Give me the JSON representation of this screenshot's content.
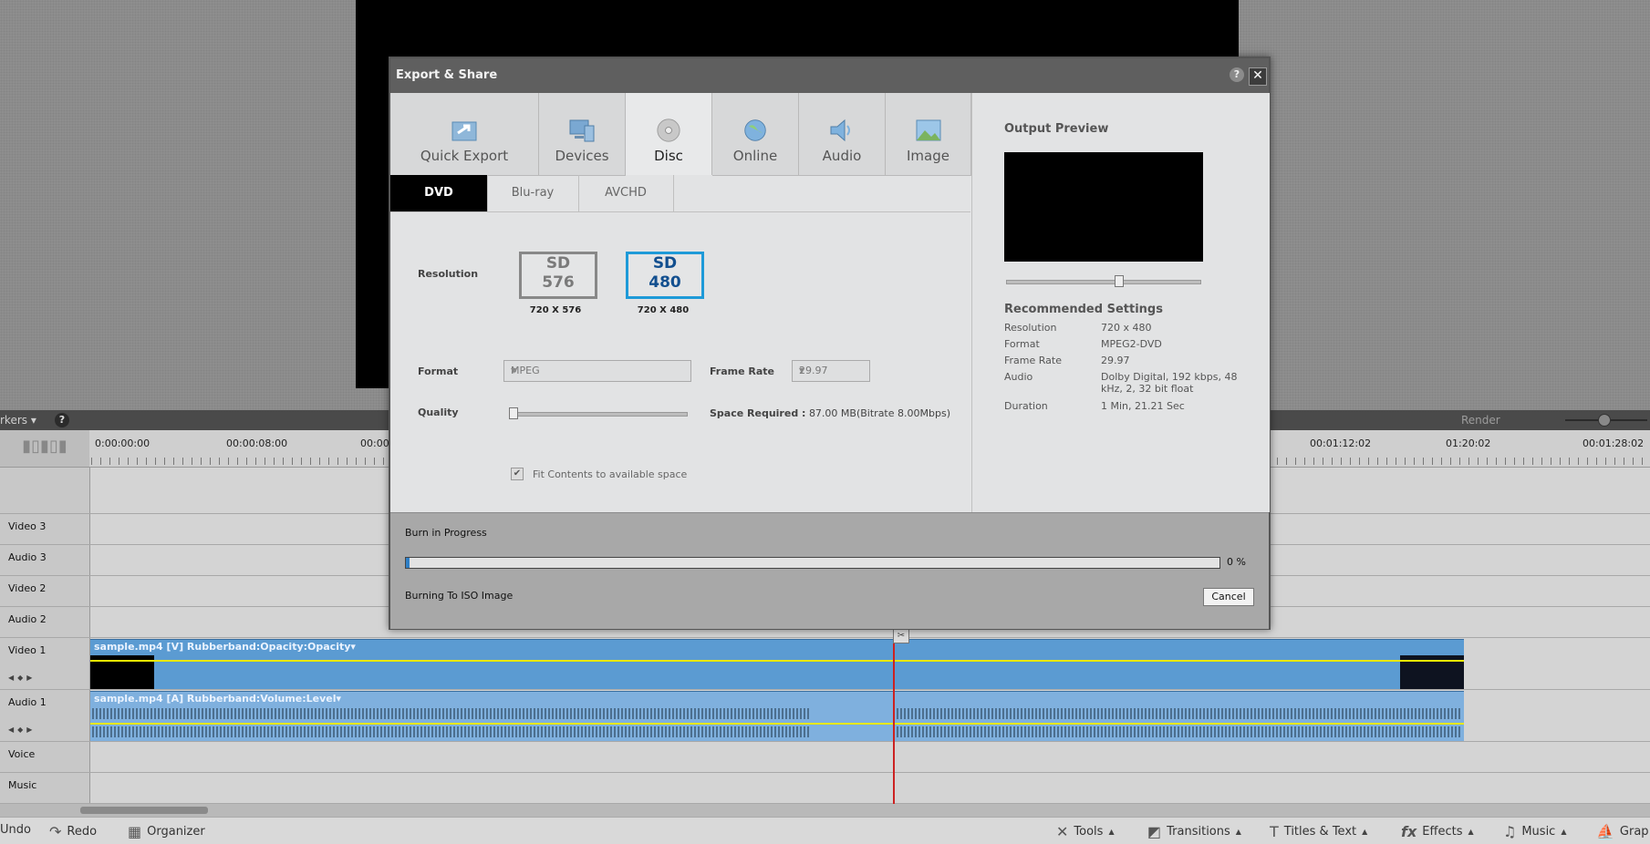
{
  "timeline": {
    "markers_label": "rkers",
    "help": "?",
    "render_label": "Render",
    "timecodes": [
      "0:00:00:00",
      "00:00:08:00",
      "00:00",
      "00:01:12:02",
      "01:20:02",
      "00:01:28:02"
    ],
    "tracks": {
      "video3": "Video 3",
      "audio3": "Audio 3",
      "video2": "Video 2",
      "audio2": "Audio 2",
      "video1": "Video 1",
      "audio1": "Audio 1",
      "voice": "Voice",
      "music": "Music"
    },
    "clips": {
      "video1_title": "sample.mp4 [V] Rubberband:Opacity:Opacity",
      "audio1_title": "sample.mp4 [A] Rubberband:Volume:Level"
    }
  },
  "bottom_bar": {
    "undo": "Undo",
    "redo": "Redo",
    "organizer": "Organizer",
    "tools": "Tools",
    "transitions": "Transitions",
    "titles": "Titles & Text",
    "effects": "Effects",
    "music": "Music",
    "graphics": "Grap"
  },
  "dialog": {
    "title": "Export & Share",
    "help": "?",
    "close": "✕",
    "categories": [
      "Quick Export",
      "Devices",
      "Disc",
      "Online",
      "Audio",
      "Image"
    ],
    "active_category": "Disc",
    "subtabs": [
      "DVD",
      "Blu-ray",
      "AVCHD"
    ],
    "active_subtab": "DVD",
    "resolution_label": "Resolution",
    "res_options": [
      {
        "line1": "SD",
        "line2": "576",
        "caption": "720 X 576"
      },
      {
        "line1": "SD",
        "line2": "480",
        "caption": "720 X 480"
      }
    ],
    "format_label": "Format",
    "format_value": "MPEG",
    "frame_rate_label": "Frame Rate",
    "frame_rate_value": "29.97",
    "quality_label": "Quality",
    "quality_level": 0.02,
    "space_required_label": "Space Required :",
    "space_required_value": "87.00 MB(Bitrate 8.00Mbps)",
    "fit_label": "Fit Contents to available space",
    "output_preview_label": "Output Preview",
    "preview_slider_level": 0.58,
    "recommended_label": "Recommended Settings",
    "recommended": [
      {
        "key": "Resolution",
        "value": "720 x 480"
      },
      {
        "key": "Format",
        "value": "MPEG2-DVD"
      },
      {
        "key": "Frame Rate",
        "value": "29.97"
      },
      {
        "key": "Audio",
        "value": "Dolby Digital, 192 kbps, 48 kHz, 2, 32 bit float"
      },
      {
        "key": "Duration",
        "value": "1 Min, 21.21 Sec"
      }
    ],
    "burn_label": "Burn in Progress",
    "progress_text": "0 %",
    "progress_value": 0.005,
    "status_text": "Burning To ISO Image",
    "cancel_label": "Cancel"
  },
  "colors": {
    "accent_selected": "#1e9ad8",
    "clip_video": "#5b9bd2",
    "playhead": "#cc2222"
  }
}
